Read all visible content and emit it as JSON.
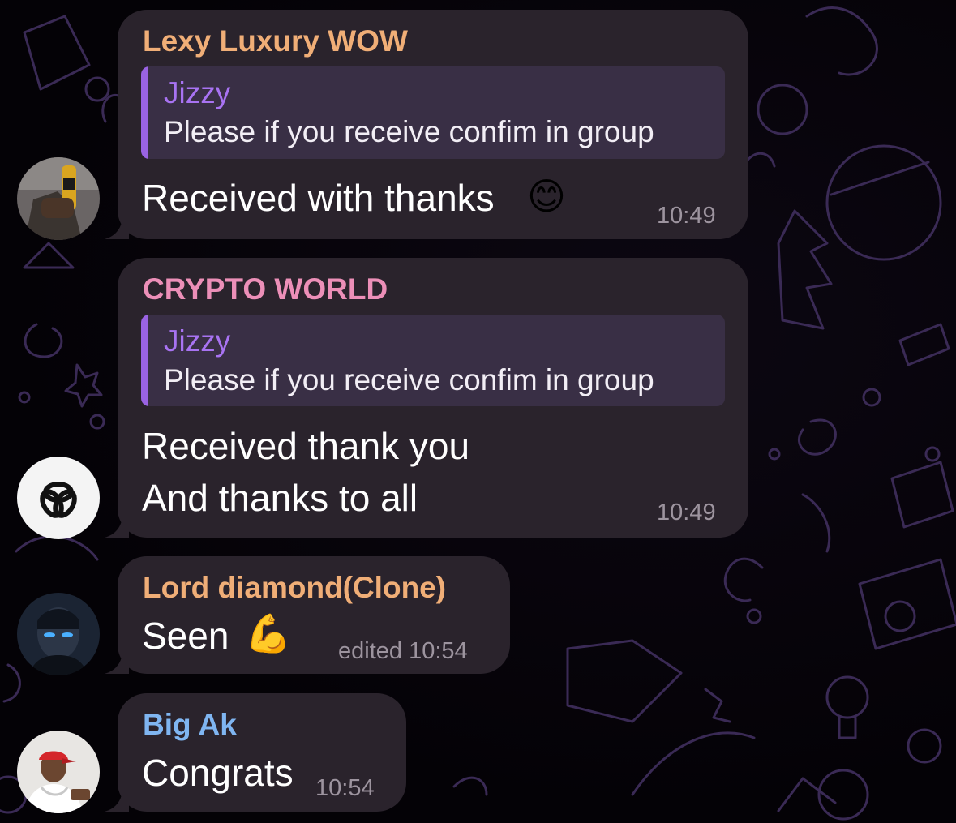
{
  "messages": [
    {
      "sender": "Lexy Luxury WOW",
      "sender_color": "#f0ae77",
      "reply": {
        "name": "Jizzy",
        "text": "Please if you receive confim in group"
      },
      "text": "Received with thanks",
      "emoji": "😊",
      "time": "10:49"
    },
    {
      "sender": "CRYPTO WORLD",
      "sender_color": "#ec8fb8",
      "reply": {
        "name": "Jizzy",
        "text": "Please if you receive confim in group"
      },
      "line1": "Received thank you",
      "line2": "And thanks to all",
      "time": "10:49"
    },
    {
      "sender": "Lord diamond(Clone)",
      "sender_color": "#f0ae77",
      "text": "Seen",
      "emoji": "💪",
      "time": "edited 10:54"
    },
    {
      "sender": "Big Ak",
      "sender_color": "#7fb5f1",
      "text": "Congrats",
      "time": "10:54"
    }
  ],
  "icons": {
    "avatar_1": "photo-avatar-icon",
    "avatar_2": "chain-link-logo-icon",
    "avatar_3": "masked-man-avatar-icon",
    "avatar_4": "red-cap-man-avatar-icon"
  }
}
